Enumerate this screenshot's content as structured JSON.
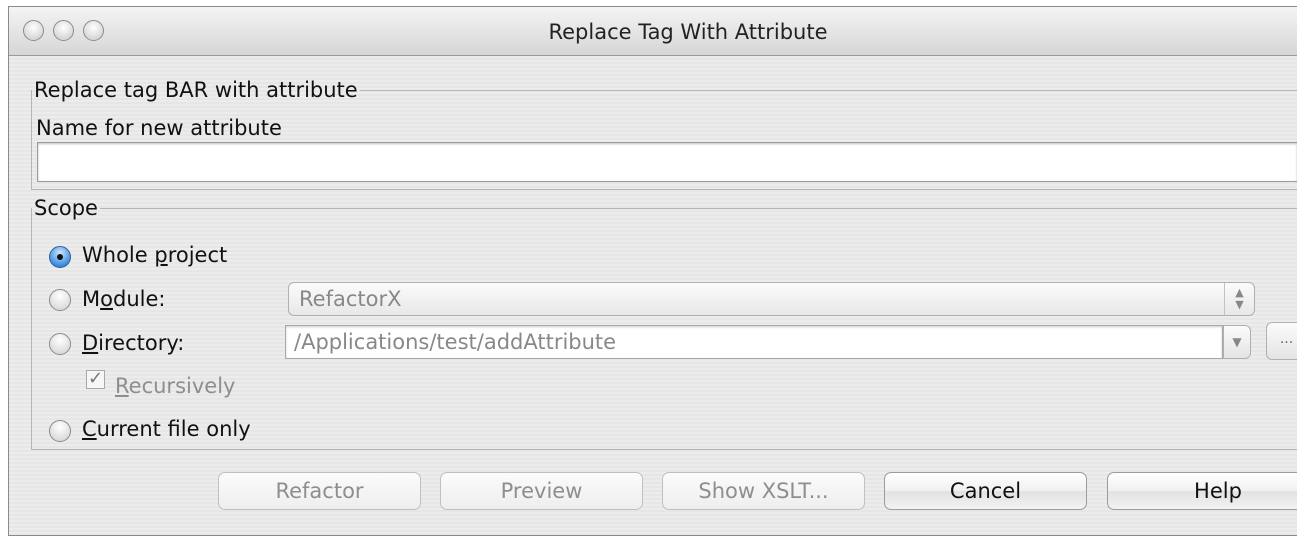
{
  "window": {
    "title": "Replace Tag With Attribute"
  },
  "attribute_group": {
    "legend": "Replace tag BAR with attribute",
    "name_label": "Name for new attribute",
    "name_value": ""
  },
  "scope": {
    "legend": "Scope",
    "options": [
      {
        "pre": "Whole ",
        "mn": "p",
        "post": "roject",
        "checked": true
      },
      {
        "pre": "M",
        "mn": "o",
        "post": "dule:",
        "checked": false
      },
      {
        "pre": "",
        "mn": "D",
        "post": "irectory:",
        "checked": false
      },
      {
        "pre": "",
        "mn": "C",
        "post": "urrent file only",
        "checked": false
      }
    ],
    "module_value": "RefactorX",
    "directory_value": "/Applications/test/addAttribute",
    "browse_label": "...",
    "recursively": {
      "pre": "",
      "mn": "R",
      "post": "ecursively",
      "checked": true,
      "mark": "✓"
    }
  },
  "buttons": {
    "refactor": "Refactor",
    "preview": "Preview",
    "show_xslt": "Show XSLT...",
    "cancel": "Cancel",
    "help": "Help"
  },
  "icons": {
    "stepper": "up-down-arrows",
    "dropdown": "down-triangle",
    "radio_selected_color": "#3f8fe0"
  }
}
